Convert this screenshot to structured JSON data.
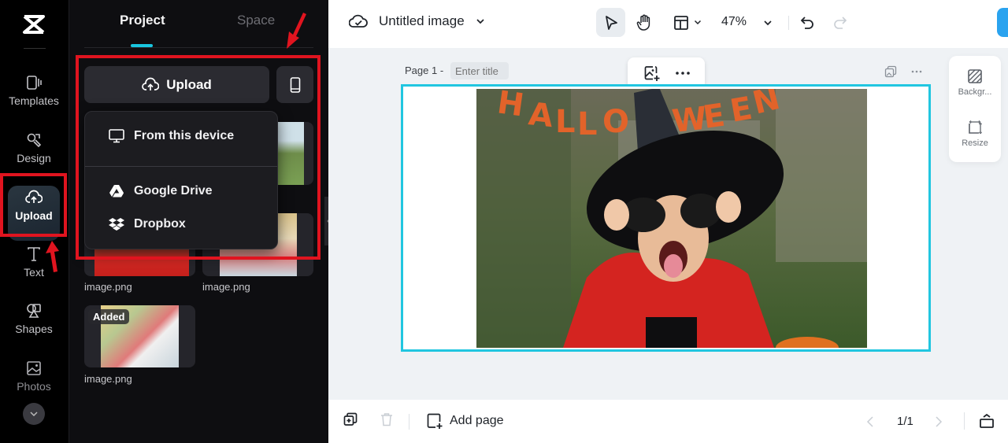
{
  "app": {
    "brand": "CapCut"
  },
  "rail": {
    "items": [
      {
        "id": "templates",
        "label": "Templates",
        "icon": "templates-icon"
      },
      {
        "id": "design",
        "label": "Design",
        "icon": "design-icon"
      },
      {
        "id": "upload",
        "label": "Upload",
        "icon": "cloud-upload-icon",
        "active": true
      },
      {
        "id": "text",
        "label": "Text",
        "icon": "text-icon"
      },
      {
        "id": "shapes",
        "label": "Shapes",
        "icon": "shapes-icon"
      },
      {
        "id": "photos",
        "label": "Photos",
        "icon": "photos-icon"
      }
    ],
    "more_icon": "chevron-down-icon"
  },
  "panel": {
    "tabs": [
      {
        "label": "Project",
        "active": true
      },
      {
        "label": "Space",
        "active": false
      }
    ],
    "upload_label": "Upload",
    "upload_menu": {
      "items": [
        {
          "label": "From this device",
          "icon": "monitor-icon"
        },
        {
          "label": "Google Drive",
          "icon": "google-drive-icon"
        },
        {
          "label": "Dropbox",
          "icon": "dropbox-icon"
        }
      ]
    },
    "files": [
      {
        "name": "image.png",
        "badge": ""
      },
      {
        "name": "image.png",
        "badge": ""
      },
      {
        "name": "image.png",
        "badge": ""
      },
      {
        "name": "image.png",
        "badge": ""
      },
      {
        "name": "image.png",
        "badge": "Added"
      }
    ]
  },
  "topbar": {
    "doc_title": "Untitled image",
    "zoom": "47%"
  },
  "canvas": {
    "page_label": "Page 1 -",
    "title_placeholder": "Enter title",
    "side_tools": [
      {
        "label": "Backgr...",
        "icon": "background-icon"
      },
      {
        "label": "Resize",
        "icon": "resize-icon"
      }
    ]
  },
  "bottombar": {
    "add_page_label": "Add page",
    "pager": "1/1"
  },
  "colors": {
    "accent": "#19c6e0",
    "highlight": "#e0141f",
    "primary_button": "#2aa3ef"
  }
}
